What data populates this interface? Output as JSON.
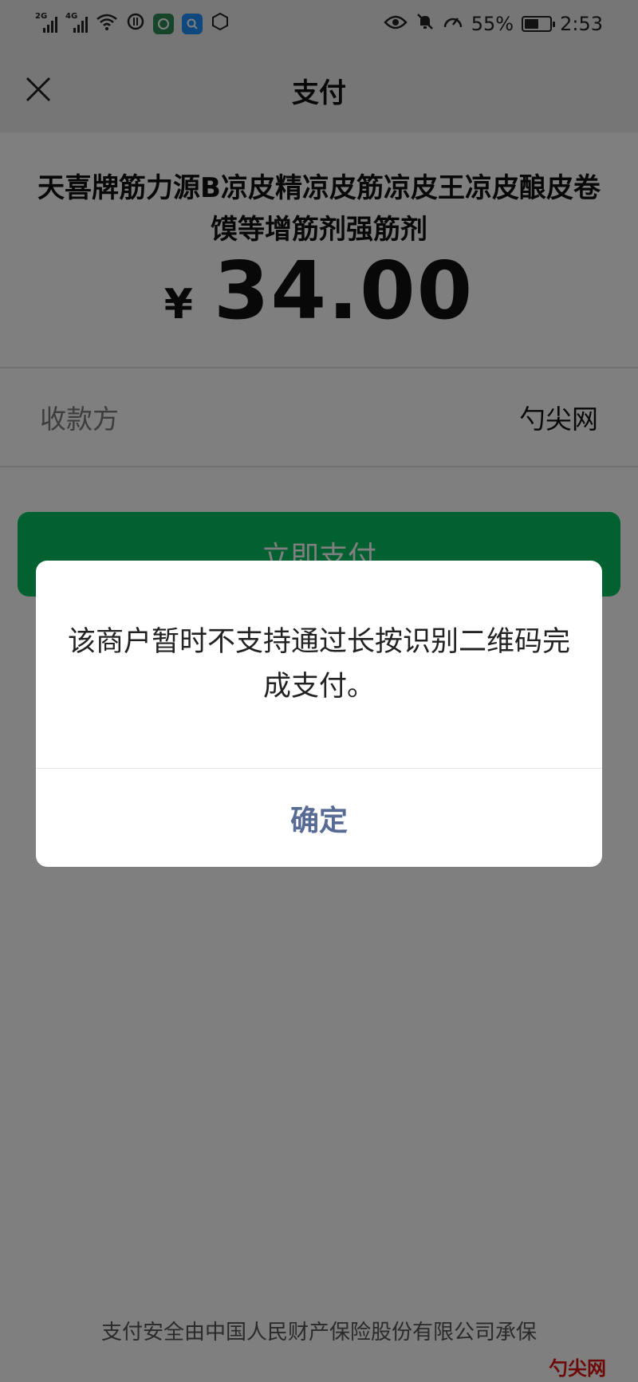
{
  "status_bar": {
    "signal1_tag": "2G",
    "signal2_tag": "4G",
    "battery_percent": "55%",
    "battery_level": 0.55,
    "time": "2:53",
    "icons": [
      "signal-icon",
      "signal-icon",
      "wifi-icon",
      "data-saver-icon",
      "app-icon",
      "search-app-icon",
      "hexagon-app-icon",
      "eye-icon",
      "bell-off-icon",
      "speedometer-icon",
      "battery-icon"
    ]
  },
  "nav": {
    "title": "支付",
    "close_icon": "close-icon"
  },
  "payment": {
    "product_title": "天喜牌筋力源B凉皮精凉皮筋凉皮王凉皮酿皮卷馍等增筋剂强筋剂",
    "currency_symbol": "¥",
    "amount": "34.00",
    "payee_label": "收款方",
    "payee_value": "勺尖网",
    "pay_button": "立即支付",
    "insurance_note": "支付安全由中国人民财产保险股份有限公司承保"
  },
  "dialog": {
    "message": "该商户暂时不支持通过长按识别二维码完成支付。",
    "confirm_button": "确定"
  },
  "watermark": "勺尖网",
  "colors": {
    "accent_green": "#07c160",
    "dialog_button": "#576b95",
    "overlay": "rgba(0,0,0,0.5)"
  }
}
